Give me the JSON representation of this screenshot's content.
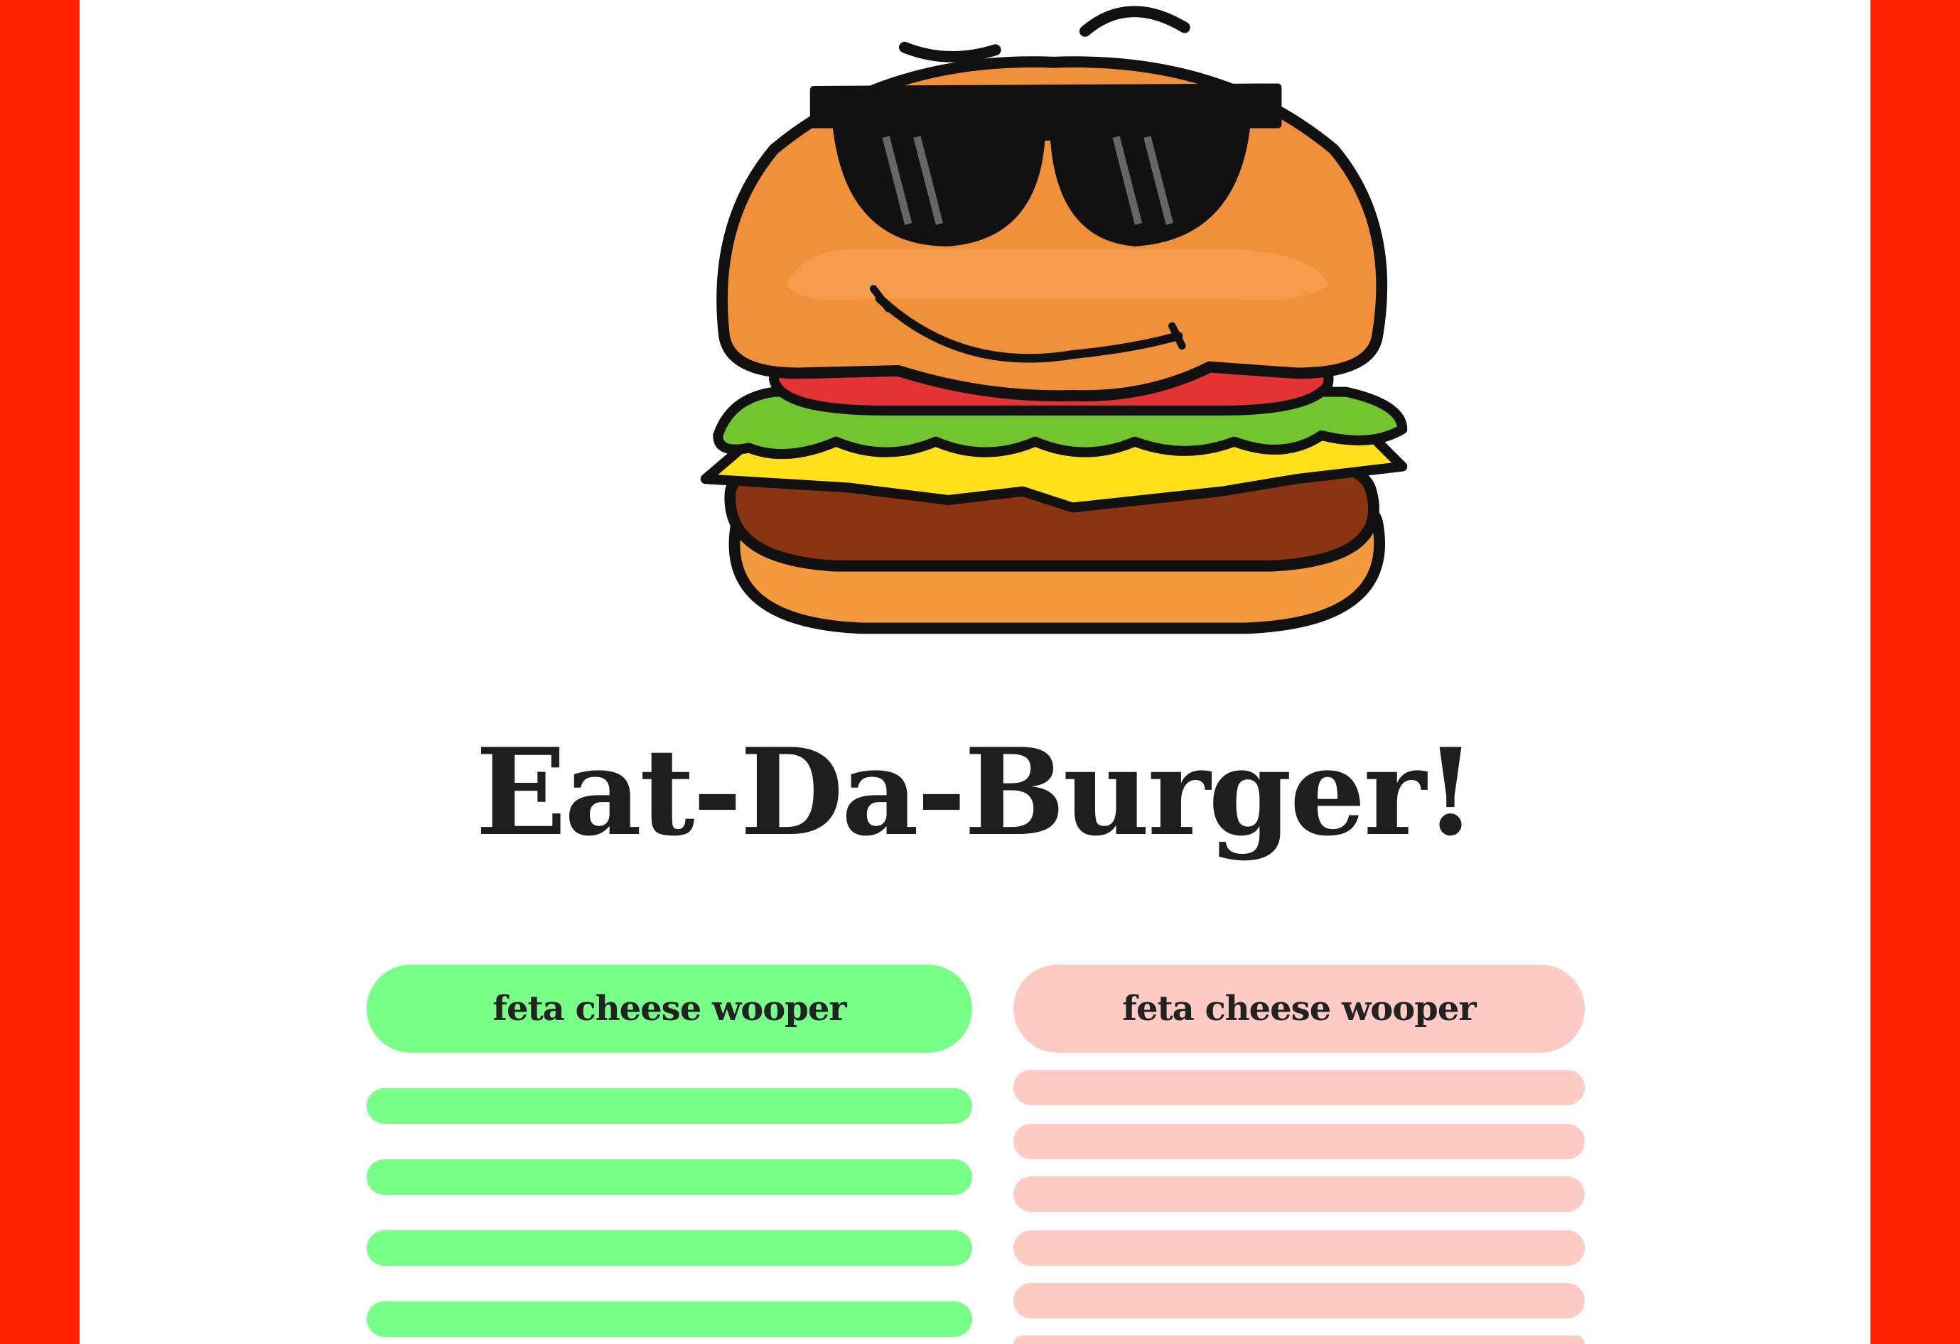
{
  "app": {
    "title": "Eat-Da-Burger!",
    "logo_icon": "cool-burger-with-sunglasses-icon"
  },
  "colors": {
    "side_bars": "#ff2200",
    "page_background": "#ffffff",
    "uneaten": "#78ff88",
    "devoured": "#ffcbc4",
    "text": "#1e1e1e"
  },
  "uneaten_list": {
    "items": [
      {
        "label": "feta cheese wooper"
      },
      {
        "label": ""
      },
      {
        "label": ""
      },
      {
        "label": ""
      },
      {
        "label": ""
      }
    ]
  },
  "devoured_list": {
    "items": [
      {
        "label": "feta cheese wooper"
      },
      {
        "label": ""
      },
      {
        "label": ""
      },
      {
        "label": ""
      },
      {
        "label": ""
      },
      {
        "label": ""
      },
      {
        "label": ""
      }
    ]
  }
}
